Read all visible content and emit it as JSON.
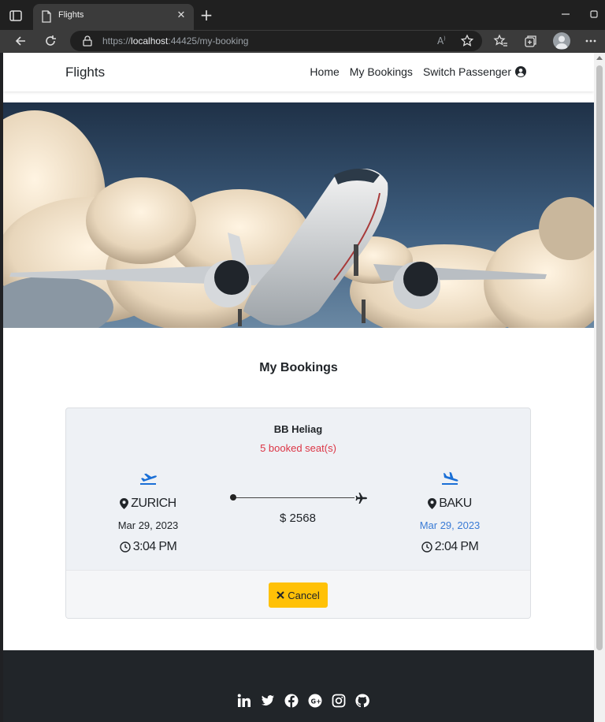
{
  "browser": {
    "tab_title": "Flights",
    "url_prefix": "https://",
    "url_host": "localhost",
    "url_rest": ":44425/my-booking",
    "icons": [
      "tab-actions-icon",
      "document-icon",
      "close-icon",
      "plus-icon",
      "minimize-icon",
      "maximize-icon",
      "back-icon",
      "reload-icon",
      "lock-icon",
      "read-aloud-icon",
      "add-favorite-icon",
      "favorites-icon",
      "collections-icon",
      "profile-icon",
      "more-icon"
    ]
  },
  "navbar": {
    "brand": "Flights",
    "links": {
      "home": "Home",
      "bookings": "My Bookings",
      "switch": "Switch Passenger"
    },
    "user_icon": "user-circle-icon"
  },
  "hero": {
    "image": "airplane-in-clouds"
  },
  "page": {
    "title": "My Bookings"
  },
  "booking": {
    "airline": "BB Heliag",
    "seats": "5 booked seat(s)",
    "origin": {
      "city": "ZURICH",
      "date": "Mar 29, 2023",
      "time": "3:04 PM",
      "icon": "plane-departure-icon"
    },
    "destination": {
      "city": "BAKU",
      "date": "Mar 29, 2023",
      "time": "2:04 PM",
      "icon": "plane-arrival-icon"
    },
    "price": "$ 2568",
    "cancel_label": "Cancel"
  },
  "footer": {
    "socials": [
      "linkedin-icon",
      "twitter-icon",
      "facebook-icon",
      "google-plus-icon",
      "instagram-icon",
      "github-icon"
    ]
  },
  "colors": {
    "accent": "#1a6fd6",
    "danger": "#dc3545",
    "warning": "#ffc107",
    "footer": "#212529",
    "chrome": "#3b3b3b"
  }
}
